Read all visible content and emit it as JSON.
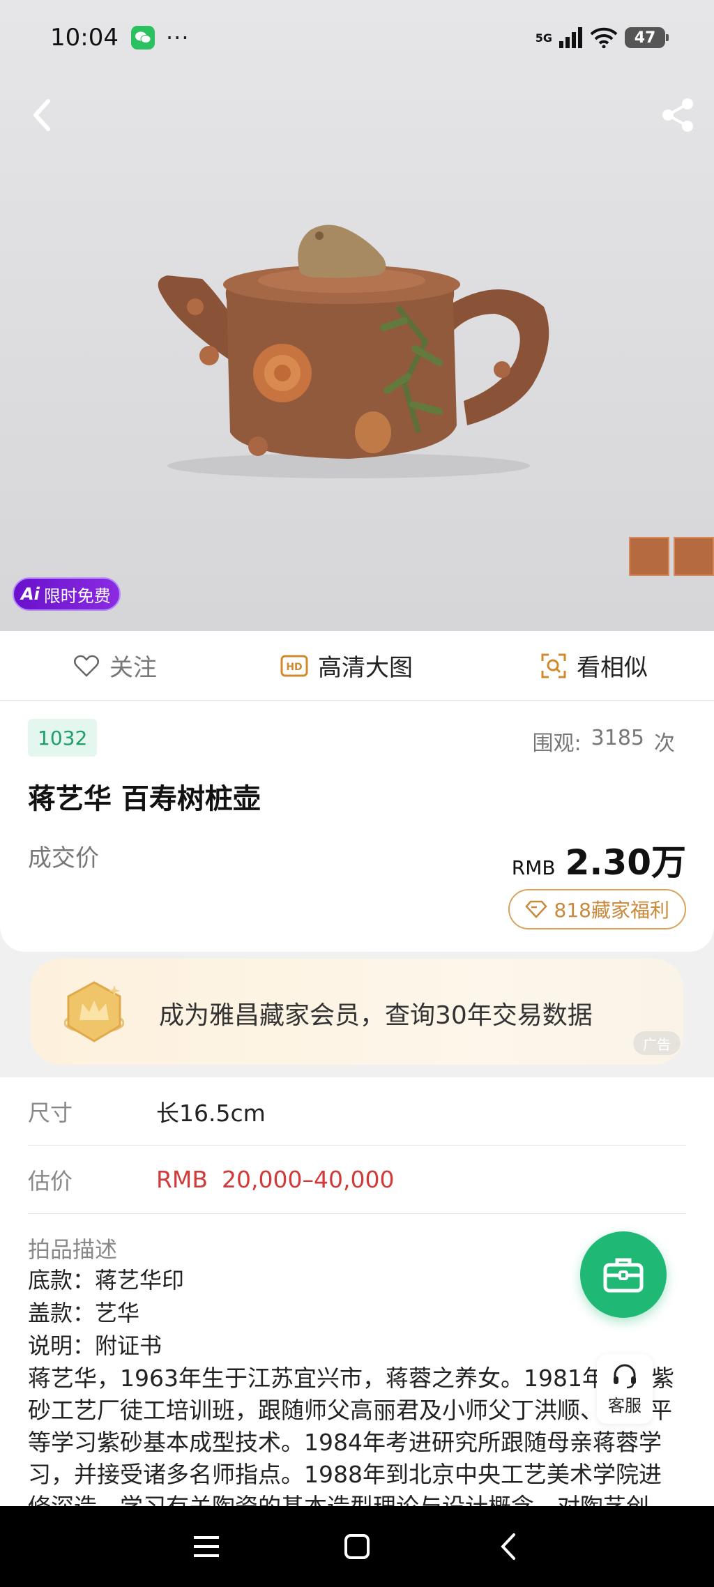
{
  "status_bar": {
    "time": "10:04",
    "signal_label": "5G",
    "battery": "47"
  },
  "hero": {
    "ai_badge_mark": "Ai",
    "ai_badge_text": "限时免费"
  },
  "actions": {
    "follow": "关注",
    "hd": "高清大图",
    "hd_icon_text": "HD",
    "similar": "看相似"
  },
  "lot": {
    "number": "1032",
    "views_label": "围观:",
    "views_count": "3185",
    "views_unit": "次",
    "title": "蒋艺华 百寿树桩壶",
    "deal_label": "成交价",
    "currency": "RMB",
    "price": "2.30万",
    "welfare": "818藏家福利"
  },
  "member_banner": {
    "text": "成为雅昌藏家会员，查询30年交易数据",
    "ad_tag": "广告"
  },
  "details": {
    "size_label": "尺寸",
    "size_value": "长16.5cm",
    "estimate_label": "估价",
    "estimate_currency": "RMB",
    "estimate_value": "20,000–40,000",
    "description_title": "拍品描述",
    "lines": [
      "底款：蒋艺华印",
      "盖款：艺华",
      "说明：附证书"
    ],
    "body": "蒋艺华，1963年生于江苏宜兴市，蒋蓉之养女。1981年进入紫砂工艺厂徒工培训班，跟随师父高丽君及小师父丁洪顺、潘持平等学习紫砂基本成型技术。1984年考进研究所跟随母亲蒋蓉学习，并接受诸多名师指点。1988年到北京中央工艺美术学院进修深造，学习有关陶瓷的基本造型理论与设计概念，对陶艺创"
  },
  "service": {
    "label": "客服"
  },
  "colors": {
    "accent_green": "#1fb975",
    "price_red": "#d23a3a",
    "gold": "#c8893a"
  }
}
